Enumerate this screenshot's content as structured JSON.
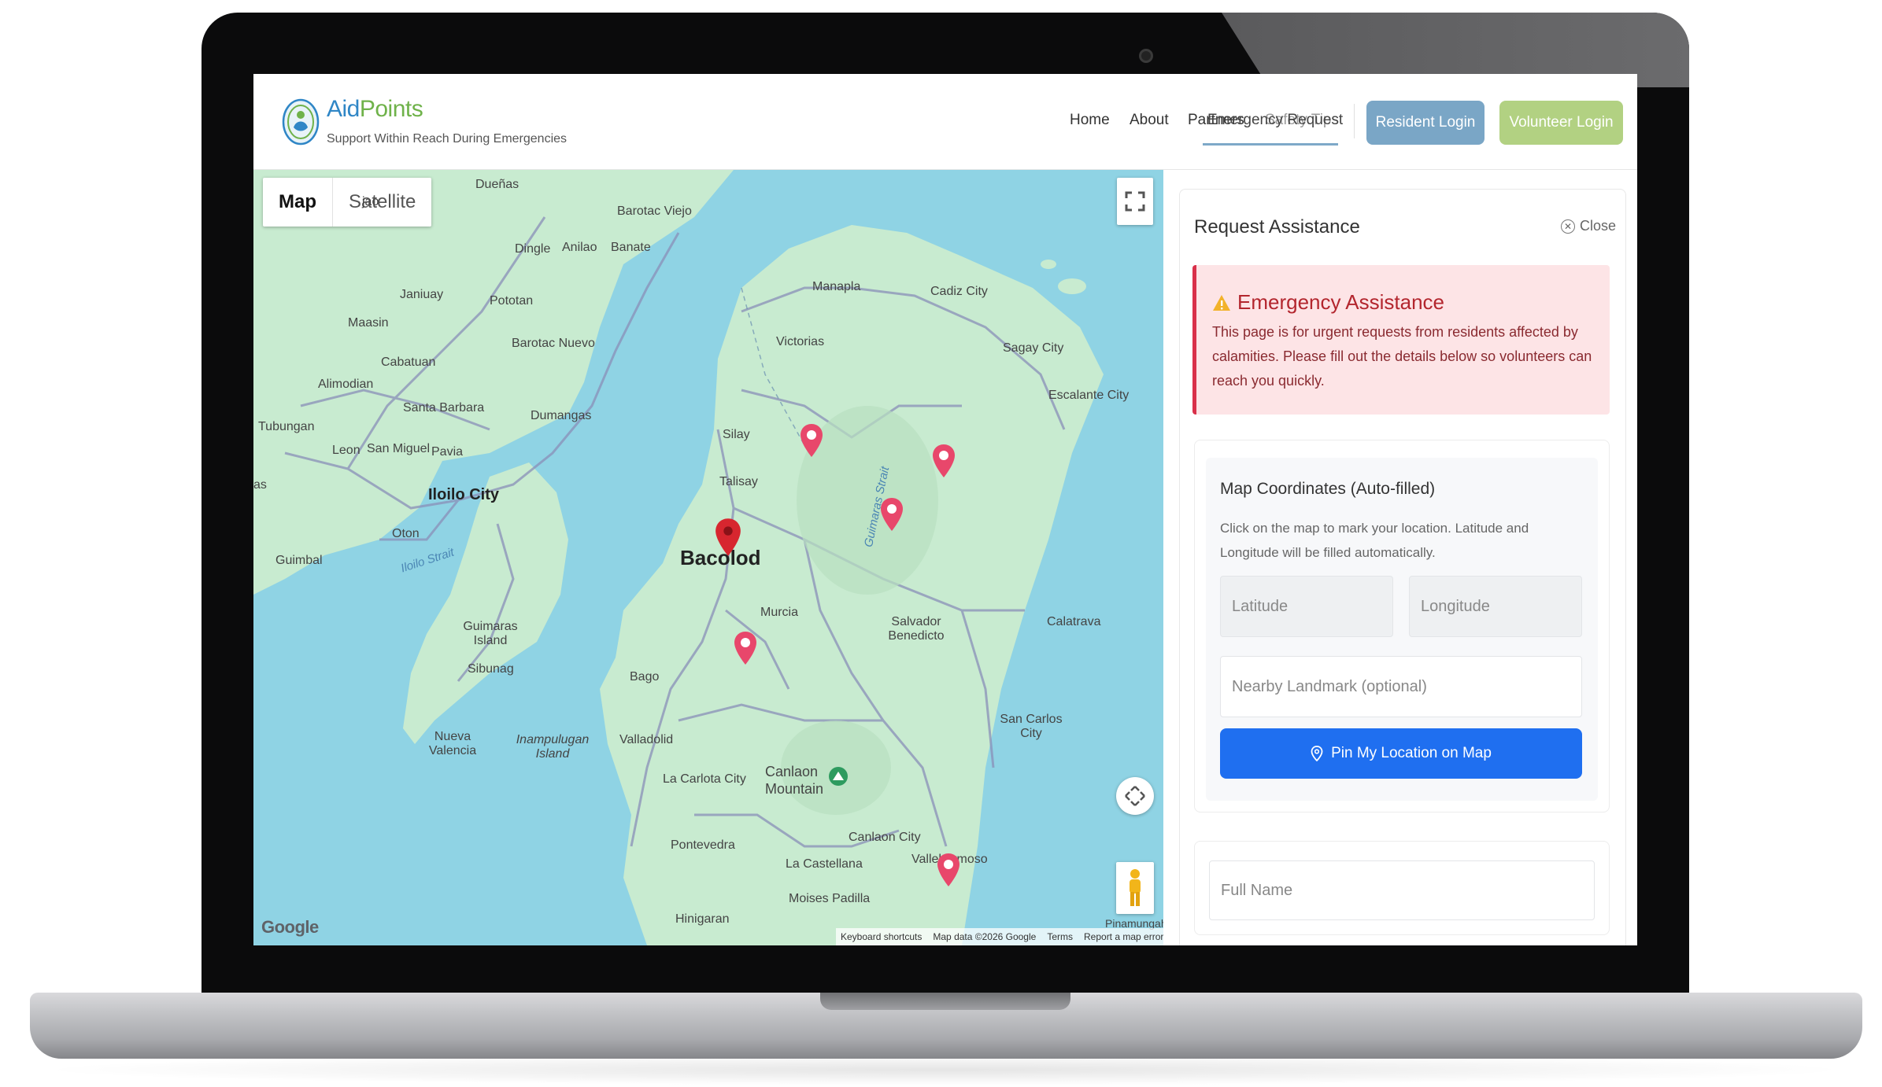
{
  "header": {
    "brand_aid": "Aid",
    "brand_points": "Points",
    "tagline": "Support Within Reach During Emergencies",
    "nav": {
      "home": "Home",
      "about": "About",
      "partners": "Partners",
      "safety_tips": "Safety Tips",
      "emergency_request": "Emergency Request"
    },
    "resident_login": "Resident Login",
    "volunteer_login": "Volunteer Login"
  },
  "map": {
    "type_map": "Map",
    "type_satellite": "Satellite",
    "google": "Google",
    "attribution": {
      "shortcuts": "Keyboard shortcuts",
      "data": "Map data ©2026 Google",
      "terms": "Terms",
      "report": "Report a map error"
    },
    "places": {
      "duenas": "Dueñas",
      "barotac_viejo": "Barotac Viejo",
      "dingle": "Dingle",
      "anilao": "Anilao",
      "banate": "Banate",
      "janiuay": "Janiuay",
      "pototan": "Pototan",
      "maasin": "Maasin",
      "barotac_nuevo": "Barotac Nuevo",
      "cabatuan": "Cabatuan",
      "alimodian": "Alimodian",
      "santa_barbara": "Santa Barbara",
      "dumangas": "Dumangas",
      "tubungan": "Tubungan",
      "leon": "Leon",
      "san_miguel": "San Miguel",
      "pavia": "Pavia",
      "iloilo_city": "Iloilo City",
      "oton": "Oton",
      "guimbal": "Guimbal",
      "iloilo_strait": "Iloilo Strait",
      "guimaras_strait": "Guimaras Strait",
      "guimaras_island": "Guimaras Island",
      "sibunag": "Sibunag",
      "nueva_valencia": "Nueva Valencia",
      "inampulugan": "Inampulugan Island",
      "manapla": "Manapla",
      "cadiz_city": "Cadiz City",
      "victorias": "Victorias",
      "sagay_city": "Sagay City",
      "escalante_city": "Escalante City",
      "silay": "Silay",
      "talisay": "Talisay",
      "bacolod": "Bacolod",
      "murcia": "Murcia",
      "salvador_benedicto": "Salvador Benedicto",
      "calatrava": "Calatrava",
      "bago": "Bago",
      "valladolid": "Valladolid",
      "san_carlos_city": "San Carlos City",
      "la_carlota": "La Carlota City",
      "canlaon_mountain": "Canlaon Mountain",
      "canlaon_city": "Canlaon City",
      "pontevedra": "Pontevedra",
      "la_castellana": "La Castellana",
      "vallehermoso": "Vallehermoso",
      "moises_padilla": "Moises Padilla",
      "hinigaran": "Hinigaran",
      "pinamungah": "Pinamungah",
      "jao": "jao",
      "as": "as"
    }
  },
  "panel": {
    "title": "Request Assistance",
    "close": "Close",
    "alert_title": "Emergency Assistance",
    "alert_text": "This page is for urgent requests from residents affected by calamities. Please fill out the details below so volunteers can reach you quickly.",
    "coords_title": "Map Coordinates (Auto-filled)",
    "coords_desc": "Click on the map to mark your location. Latitude and Longitude will be filled automatically.",
    "latitude_placeholder": "Latitude",
    "longitude_placeholder": "Longitude",
    "landmark_placeholder": "Nearby Landmark (optional)",
    "pin_button": "Pin My Location on Map",
    "fullname_placeholder": "Full Name"
  },
  "colors": {
    "brand_blue": "#2f86c6",
    "brand_green": "#6fb24a",
    "resident_btn": "#7aa6c6",
    "volunteer_btn": "#b2d182",
    "pin_btn": "#1f6ff0",
    "alert_bg": "#fde4e6",
    "alert_accent": "#d9304a",
    "marker": "#e8476b",
    "bacolod_marker": "#d7262f",
    "water": "#8fd3e4",
    "land": "#c8ebd0"
  },
  "icons": [
    "logo-icon",
    "close-icon",
    "warning-icon",
    "map-pin-icon",
    "fullscreen-icon",
    "pan-icon",
    "pegman-icon"
  ]
}
